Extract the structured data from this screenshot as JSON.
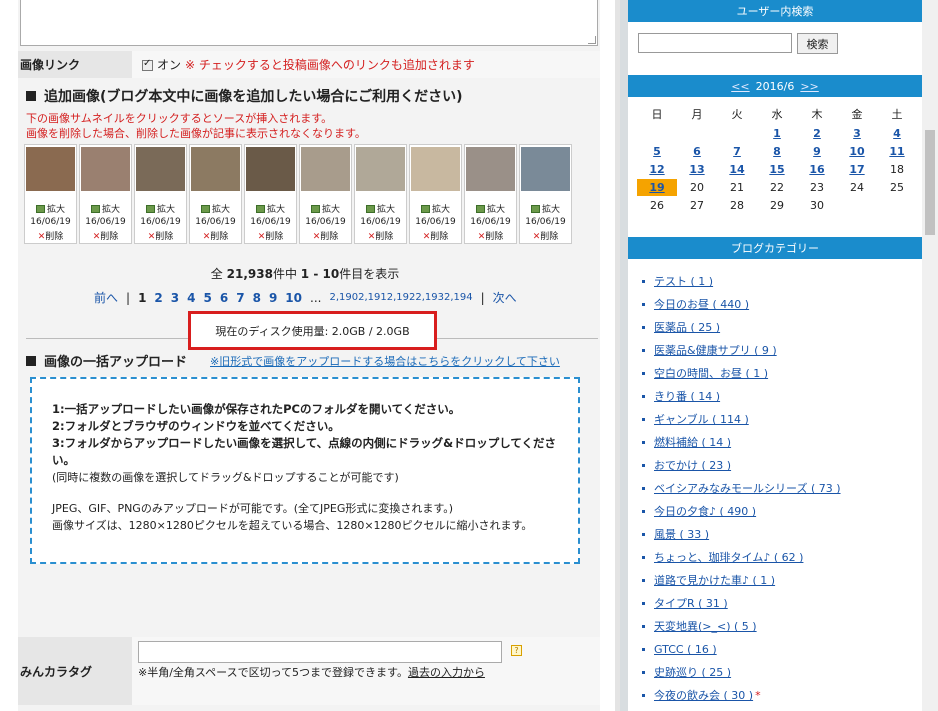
{
  "image_link": {
    "label": "画像リンク",
    "checkbox_label": "オン",
    "note": "※ チェックすると投稿画像へのリンクも追加されます"
  },
  "add_images": {
    "heading": "追加画像(ブログ本文中に画像を追加したい場合にご利用ください)",
    "note_line1": "下の画像サムネイルをクリックするとソースが挿入されます。",
    "note_line2": "画像を削除した場合、削除した画像が記事に表示されなくなります。",
    "thumbnails": [
      {
        "zoom": "拡大",
        "date": "16/06/19",
        "delete": "削除",
        "color": "#8a6a50"
      },
      {
        "zoom": "拡大",
        "date": "16/06/19",
        "delete": "削除",
        "color": "#9a8070"
      },
      {
        "zoom": "拡大",
        "date": "16/06/19",
        "delete": "削除",
        "color": "#7a6a58"
      },
      {
        "zoom": "拡大",
        "date": "16/06/19",
        "delete": "削除",
        "color": "#8c7a62"
      },
      {
        "zoom": "拡大",
        "date": "16/06/19",
        "delete": "削除",
        "color": "#6a5a48"
      },
      {
        "zoom": "拡大",
        "date": "16/06/19",
        "delete": "削除",
        "color": "#a89c8c"
      },
      {
        "zoom": "拡大",
        "date": "16/06/19",
        "delete": "削除",
        "color": "#b0a898"
      },
      {
        "zoom": "拡大",
        "date": "16/06/19",
        "delete": "削除",
        "color": "#c8b8a0"
      },
      {
        "zoom": "拡大",
        "date": "16/06/19",
        "delete": "削除",
        "color": "#9a9088"
      },
      {
        "zoom": "拡大",
        "date": "16/06/19",
        "delete": "削除",
        "color": "#7a8a98"
      }
    ],
    "count_prefix": "全",
    "count_total": "21,938",
    "count_mid": "件中",
    "count_range": "1 - 10",
    "count_suffix": "件目を表示",
    "pager": {
      "prev": "前へ",
      "current": "1",
      "pages": [
        "2",
        "3",
        "4",
        "5",
        "6",
        "7",
        "8",
        "9",
        "10"
      ],
      "ellipsis": "...",
      "far_pages": "2,1902,1912,1922,1932,194",
      "next": "次へ"
    },
    "disk_usage": "現在のディスク使用量: 2.0GB / 2.0GB"
  },
  "bulk_upload": {
    "heading": "画像の一括アップロード",
    "legacy_link": "※旧形式で画像をアップロードする場合はこちらをクリックして下さい",
    "step1": "1:一括アップロードしたい画像が保存されたPCのフォルダを開いてください。",
    "step2": "2:フォルダとブラウザのウィンドウを並べてください。",
    "step3a": "3:フォルダからアップロードしたい画像を選択して、点線の内側にドラッグ&ドロップしてくださ",
    "step3b": "い。",
    "step_note": "(同時に複数の画像を選択してドラッグ&ドロップすることが可能です)",
    "format_note": "JPEG、GIF、PNGのみアップロードが可能です。(全てJPEG形式に変換されます。)",
    "size_note": "画像サイズは、1280×1280ピクセルを超えている場合、1280×1280ピクセルに縮小されます。"
  },
  "minkara_tag": {
    "label": "みんカラタグ",
    "help": "?",
    "note": "※半角/全角スペースで区切って5つまで登録できます。",
    "history_link": "過去の入力から"
  },
  "sidebar": {
    "search_title": "ユーザー内検索",
    "search_button": "検索",
    "calendar": {
      "prev": "<<",
      "title": "2016/6",
      "next": ">>",
      "weekdays": [
        "日",
        "月",
        "火",
        "水",
        "木",
        "金",
        "土"
      ],
      "weeks": [
        [
          {
            "d": ""
          },
          {
            "d": ""
          },
          {
            "d": ""
          },
          {
            "d": "1",
            "link": true
          },
          {
            "d": "2",
            "link": true
          },
          {
            "d": "3",
            "link": true
          },
          {
            "d": "4",
            "link": true
          }
        ],
        [
          {
            "d": "5",
            "link": true
          },
          {
            "d": "6",
            "link": true
          },
          {
            "d": "7",
            "link": true
          },
          {
            "d": "8",
            "link": true
          },
          {
            "d": "9",
            "link": true
          },
          {
            "d": "10",
            "link": true
          },
          {
            "d": "11",
            "link": true
          }
        ],
        [
          {
            "d": "12",
            "link": true
          },
          {
            "d": "13",
            "link": true
          },
          {
            "d": "14",
            "link": true
          },
          {
            "d": "15",
            "link": true
          },
          {
            "d": "16",
            "link": true
          },
          {
            "d": "17",
            "link": true
          },
          {
            "d": "18"
          }
        ],
        [
          {
            "d": "19",
            "link": true,
            "today": true
          },
          {
            "d": "20"
          },
          {
            "d": "21"
          },
          {
            "d": "22"
          },
          {
            "d": "23"
          },
          {
            "d": "24"
          },
          {
            "d": "25"
          }
        ],
        [
          {
            "d": "26"
          },
          {
            "d": "27"
          },
          {
            "d": "28"
          },
          {
            "d": "29"
          },
          {
            "d": "30"
          },
          {
            "d": ""
          },
          {
            "d": ""
          }
        ]
      ]
    },
    "category_title": "ブログカテゴリー",
    "categories": [
      {
        "label": "テスト ( 1 )"
      },
      {
        "label": "今日のお昼 ( 440 )"
      },
      {
        "label": "医薬品 ( 25 )"
      },
      {
        "label": "医薬品&健康サプリ ( 9 )"
      },
      {
        "label": "空白の時間、お昼 ( 1 )"
      },
      {
        "label": "きり番 ( 14 )"
      },
      {
        "label": "ギャンブル ( 114 )"
      },
      {
        "label": "燃料補給 ( 14 )"
      },
      {
        "label": "おでかけ ( 23 )"
      },
      {
        "label": "ベイシアみなみモールシリーズ ( 73 )"
      },
      {
        "label": "今日の夕食♪ ( 490 )"
      },
      {
        "label": "風景 ( 33 )"
      },
      {
        "label": "ちょっと、珈琲タイム♪ ( 62 )"
      },
      {
        "label": "道路で見かけた車♪ ( 1 )"
      },
      {
        "label": "タイプR ( 31 )"
      },
      {
        "label": "天変地異(>_<) ( 5 )"
      },
      {
        "label": "GTCC ( 16 )"
      },
      {
        "label": "史跡巡り ( 25 )"
      },
      {
        "label": "今夜の飲み会 ( 30 )",
        "star": "*"
      }
    ]
  }
}
